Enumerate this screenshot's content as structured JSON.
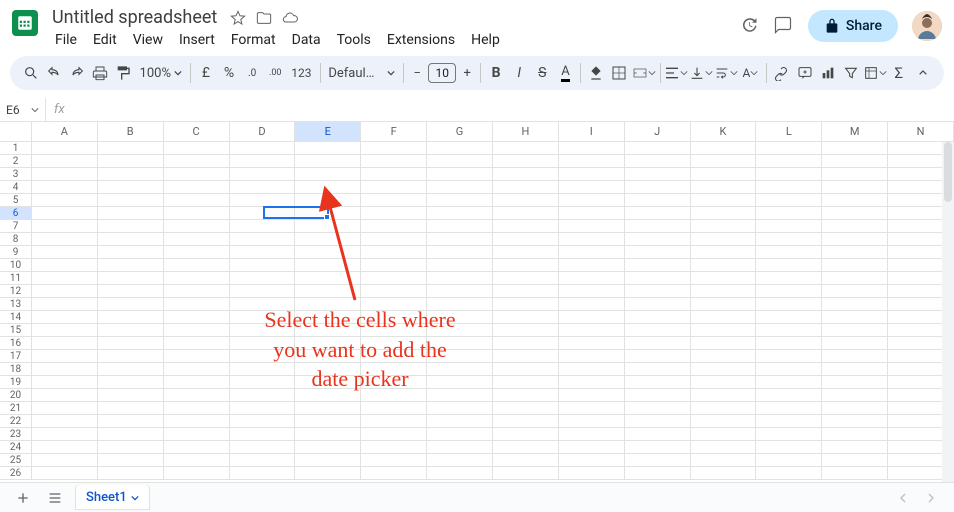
{
  "header": {
    "doc_title": "Untitled spreadsheet",
    "menus": [
      "File",
      "Edit",
      "View",
      "Insert",
      "Format",
      "Data",
      "Tools",
      "Extensions",
      "Help"
    ],
    "share_label": "Share"
  },
  "toolbar": {
    "zoom": "100%",
    "font": "Defaul…",
    "font_size": "10",
    "currency_symbol": "£",
    "percent_symbol": "%",
    "decrease_decimal": ".0←",
    "increase_decimal": ".00→",
    "format123": "123"
  },
  "formula_bar": {
    "name_box": "E6",
    "fx": "fx",
    "value": ""
  },
  "grid": {
    "columns": [
      "A",
      "B",
      "C",
      "D",
      "E",
      "F",
      "G",
      "H",
      "I",
      "J",
      "K",
      "L",
      "M",
      "N"
    ],
    "rows": [
      1,
      2,
      3,
      4,
      5,
      6,
      7,
      8,
      9,
      10,
      11,
      12,
      13,
      14,
      15,
      16,
      17,
      18,
      19,
      20,
      21,
      22,
      23,
      24,
      25,
      26
    ],
    "selected_cell": "E6",
    "selected_col_index": 4,
    "selected_row_index": 5
  },
  "annotation": {
    "text_l1": "Select the cells where",
    "text_l2": "you want to add the",
    "text_l3": "date picker"
  },
  "sheet_tabs": {
    "active": "Sheet1"
  }
}
